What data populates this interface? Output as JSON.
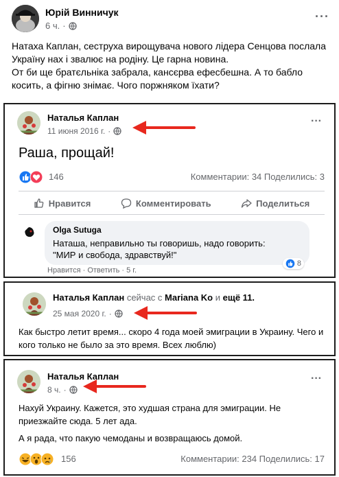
{
  "post": {
    "author": "Юрій Винничук",
    "time": "6 ч.",
    "more": "···",
    "text": [
      "Натаха Каплан, сеструха вирощувача нового лідера Сенцова послала Україну нах і звалює на родіну. Це гарна новина.",
      "От би ще братєльніка забрала, кансєрва ефесбешна. А то бабло косить, а фігню знімає. Чого поржняком їхати?"
    ]
  },
  "screenshot1": {
    "author": "Наталья Каплан",
    "date": "11 июня 2016 г.",
    "more": "···",
    "text": "Раша, прощай!",
    "reaction_count": "146",
    "stats": "Комментарии: 34  Поделились: 3",
    "actions": {
      "like": "Нравится",
      "comment": "Комментировать",
      "share": "Поделиться"
    },
    "comment": {
      "author": "Olga Sutuga",
      "line1": "Наташа, неправильно ты говоришь, надо говорить:",
      "line2": "\"МИР и свобода, здравствуй!\"",
      "likes": "8",
      "actions": "Нравится · Ответить · 5 г."
    }
  },
  "screenshot2": {
    "author": "Наталья Каплан",
    "with_text": "сейчас с",
    "friend": "Mariana Ko",
    "and_text": "и",
    "others": "ещё 11.",
    "date": "25 мая 2020 г.",
    "text": "Как быстро летит время... скоро 4 года моей эмиграции в Украину. Чего и кого только не было за это время. Всех люблю)"
  },
  "screenshot3": {
    "author": "Наталья Каплан",
    "date": "8 ч.",
    "more": "···",
    "text1": "Нахуй Украину. Кажется, это худшая страна для эмиграции. Не приезжайте сюда. 5 лет ада.",
    "text2": "А я рада, что пакую чемоданы и возвращаюсь домой.",
    "reaction_count": "156",
    "stats": "Комментарии: 234  Поделились: 17"
  },
  "colors": {
    "fb_blue": "#1877f2",
    "arrow_red": "#e8281e",
    "meta_gray": "#65676b",
    "bubble_bg": "#f0f2f5"
  },
  "icons": [
    "globe-icon",
    "like-icon",
    "heart-icon",
    "comment-icon",
    "share-icon",
    "arrow-icon",
    "haha-icon",
    "wow-icon",
    "sad-icon"
  ]
}
